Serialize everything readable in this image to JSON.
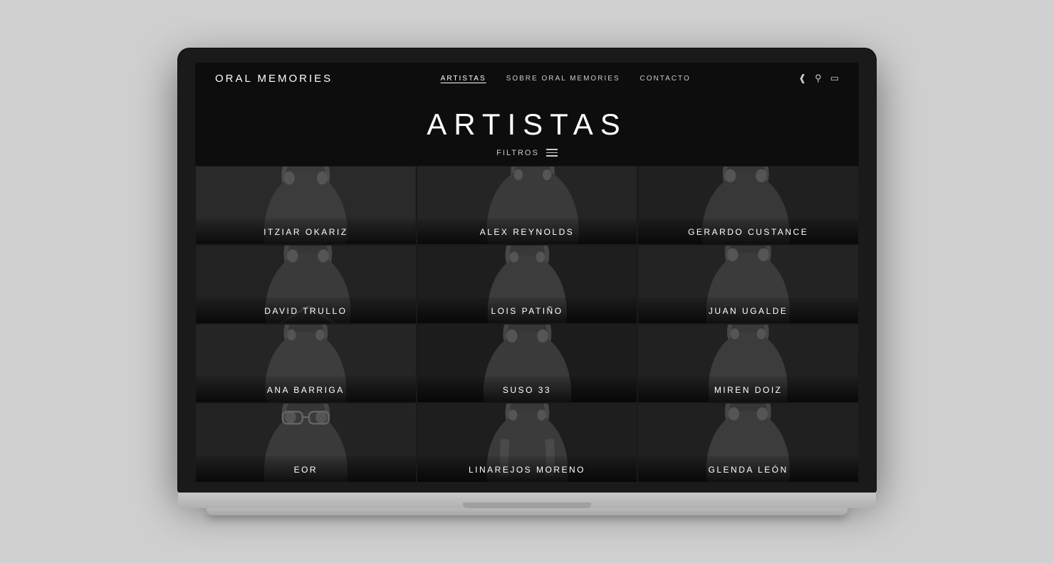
{
  "laptop": {
    "screen_bg": "#0d0d0d"
  },
  "navbar": {
    "logo": "ORAL MEMORIES",
    "links": [
      {
        "label": "ARTISTAS",
        "active": true
      },
      {
        "label": "SOBRE ORAL MEMORIES",
        "active": false
      },
      {
        "label": "CONTACTO",
        "active": false
      }
    ],
    "icons": {
      "share": "share-icon",
      "search": "search-icon",
      "screen": "screen-icon"
    }
  },
  "page": {
    "title": "ARTISTAS",
    "filters_label": "FILTROS"
  },
  "artists": [
    {
      "name": "ITZIAR OKARIZ",
      "fig": "fig-1"
    },
    {
      "name": "ALEX REYNOLDS",
      "fig": "fig-2"
    },
    {
      "name": "GERARDO CUSTANCE",
      "fig": "fig-3"
    },
    {
      "name": "DAVID TRULLO",
      "fig": "fig-4"
    },
    {
      "name": "LOIS PATIÑO",
      "fig": "fig-5"
    },
    {
      "name": "JUAN UGALDE",
      "fig": "fig-6"
    },
    {
      "name": "ANA BARRIGA",
      "fig": "fig-7"
    },
    {
      "name": "SUSO 33",
      "fig": "fig-8"
    },
    {
      "name": "MIREN DOIZ",
      "fig": "fig-9"
    },
    {
      "name": "EOR",
      "fig": "fig-10"
    },
    {
      "name": "LINAREJOS MORENO",
      "fig": "fig-11"
    },
    {
      "name": "GLENDA LEÓN",
      "fig": "fig-12"
    }
  ]
}
